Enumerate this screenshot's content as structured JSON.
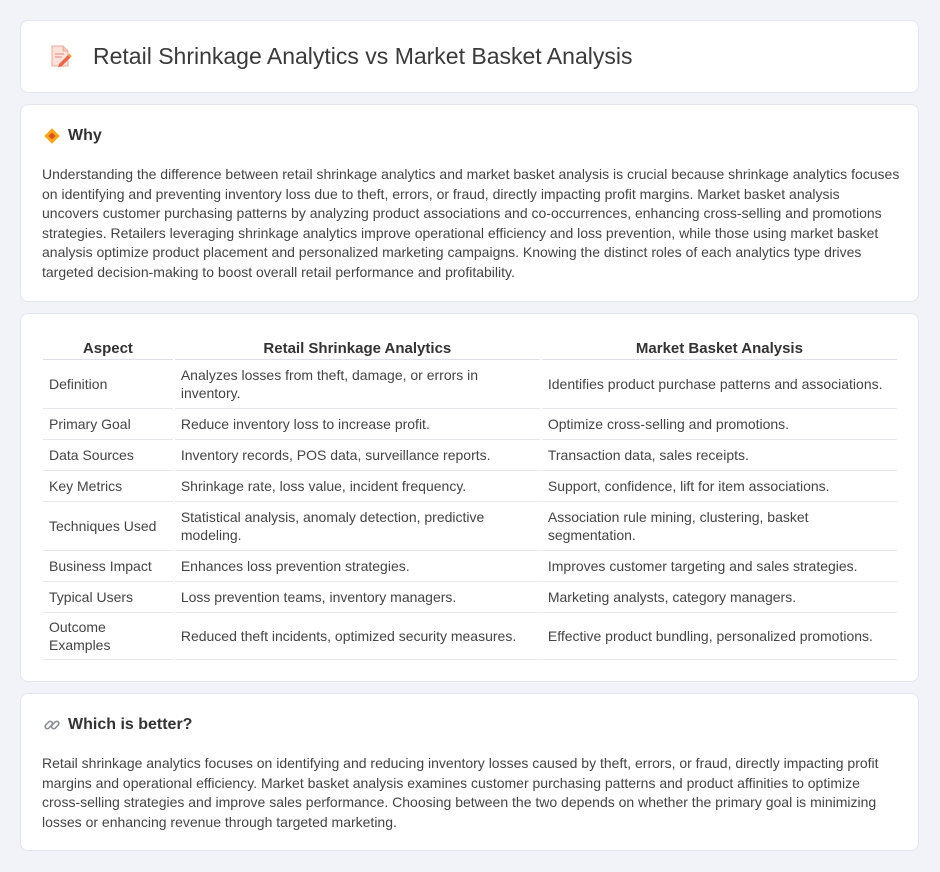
{
  "header": {
    "title": "Retail Shrinkage Analytics vs Market Basket Analysis",
    "icon": "document-pencil-icon"
  },
  "why": {
    "title": "Why",
    "icon": "diamond-icon",
    "text": "Understanding the difference between retail shrinkage analytics and market basket analysis is crucial because shrinkage analytics focuses on identifying and preventing inventory loss due to theft, errors, or fraud, directly impacting profit margins. Market basket analysis uncovers customer purchasing patterns by analyzing product associations and co-occurrences, enhancing cross-selling and promotions strategies. Retailers leveraging shrinkage analytics improve operational efficiency and loss prevention, while those using market basket analysis optimize product placement and personalized marketing campaigns. Knowing the distinct roles of each analytics type drives targeted decision-making to boost overall retail performance and profitability."
  },
  "table": {
    "headers": [
      "Aspect",
      "Retail Shrinkage Analytics",
      "Market Basket Analysis"
    ],
    "rows": [
      [
        "Definition",
        "Analyzes losses from theft, damage, or errors in inventory.",
        "Identifies product purchase patterns and associations."
      ],
      [
        "Primary Goal",
        "Reduce inventory loss to increase profit.",
        "Optimize cross-selling and promotions."
      ],
      [
        "Data Sources",
        "Inventory records, POS data, surveillance reports.",
        "Transaction data, sales receipts."
      ],
      [
        "Key Metrics",
        "Shrinkage rate, loss value, incident frequency.",
        "Support, confidence, lift for item associations."
      ],
      [
        "Techniques Used",
        "Statistical analysis, anomaly detection, predictive modeling.",
        "Association rule mining, clustering, basket segmentation."
      ],
      [
        "Business Impact",
        "Enhances loss prevention strategies.",
        "Improves customer targeting and sales strategies."
      ],
      [
        "Typical Users",
        "Loss prevention teams, inventory managers.",
        "Marketing analysts, category managers."
      ],
      [
        "Outcome Examples",
        "Reduced theft incidents, optimized security measures.",
        "Effective product bundling, personalized promotions."
      ]
    ]
  },
  "better": {
    "title": "Which is better?",
    "icon": "link-icon",
    "text": "Retail shrinkage analytics focuses on identifying and reducing inventory losses caused by theft, errors, or fraud, directly impacting profit margins and operational efficiency. Market basket analysis examines customer purchasing patterns and product affinities to optimize cross-selling strategies and improve sales performance. Choosing between the two depends on whether the primary goal is minimizing losses or enhancing revenue through targeted marketing."
  }
}
